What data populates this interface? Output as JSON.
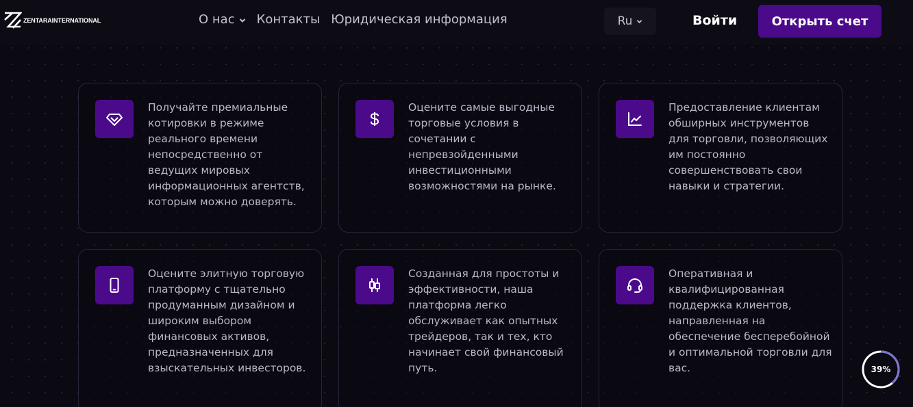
{
  "header": {
    "logo_text": "ZENTARAINTERNATIONAL",
    "nav": [
      {
        "label": "О нас",
        "has_dropdown": true
      },
      {
        "label": "Контакты",
        "has_dropdown": false
      },
      {
        "label": "Юридическая информация",
        "has_dropdown": false
      }
    ],
    "language": "Ru",
    "login_label": "Войти",
    "open_account_label": "Открыть счет"
  },
  "features": [
    {
      "icon": "diamond-icon",
      "text": "Получайте премиальные котировки в режиме реального времени непосредственно от ведущих мировых информационных агентств, которым можно доверять."
    },
    {
      "icon": "dollar-icon",
      "text": "Оцените самые выгодные торговые условия в сочетании с непревзойденными инвестиционными возможностями на рынке."
    },
    {
      "icon": "chart-line-icon",
      "text": "Предоставление клиентам обширных инструментов для торговли, позволяющих им постоянно совершенствовать свои навыки и стратегии."
    },
    {
      "icon": "smartphone-icon",
      "text": "Оцените элитную торговую платформу с тщательно продуманным дизайном и широким выбором финансовых активов, предназначенных для взыскательных инвесторов."
    },
    {
      "icon": "candlestick-icon",
      "text": "Созданная для простоты и эффективности, наша платформа легко обслуживает как опытных трейдеров, так и тех, кто начинает свой финансовый путь."
    },
    {
      "icon": "headset-icon",
      "text": "Оперативная и квалифицированная поддержка клиентов, направленная на обеспечение бесперебойной и оптимальной торговли для вас."
    }
  ],
  "scroll_progress": {
    "label": "39%",
    "value": 0.39
  },
  "colors": {
    "accent": "#4b0a8a",
    "background": "#0b0a12",
    "progress_ring": "#7b74d6"
  }
}
